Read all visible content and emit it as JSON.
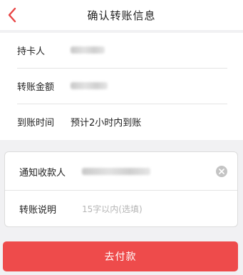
{
  "header": {
    "title": "确认转账信息",
    "back_icon": "chevron-left-icon",
    "accent_color": "#e84545"
  },
  "transfer_info": {
    "holder_label": "持卡人",
    "amount_label": "转账金额",
    "arrival_label": "到账时间",
    "arrival_value": "预计2小时内到账"
  },
  "notify": {
    "payee_label": "通知收款人",
    "clear_icon": "clear-icon",
    "note_label": "转账说明",
    "note_placeholder": "15字以内(选填)"
  },
  "actions": {
    "pay_label": "去付款",
    "pay_color": "#ee4b4b"
  }
}
